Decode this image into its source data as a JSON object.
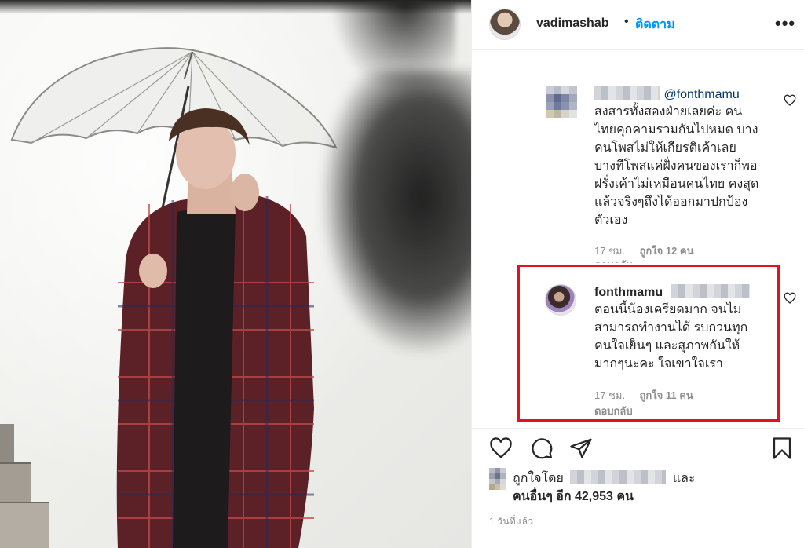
{
  "header": {
    "username": "vadimashab",
    "dot": "•",
    "follow_label": "ติดตาม",
    "more_label": "•••"
  },
  "comments": [
    {
      "mention": "@fonthmamu",
      "text": "สงสารทั้งสองฝ่ายเลยค่ะ คน\nไทยคุกคามรวมกันไปหมด บาง\nคนโพสไม่ให้เกียรติเค้าเลย\nบางทีโพสแค่ฝั่งคนของเราก็พอ\nฝรั่งเค้าไม่เหมือนคนไทย คงสุด\nแล้วจริงๆถึงได้ออกมาปกป้อง\nตัวเอง",
      "time": "17 ชม.",
      "likes": "ถูกใจ 12 คน",
      "reply": "ตอบกลับ"
    },
    {
      "username": "fonthmamu",
      "text": "ตอนนี้น้องเครียดมาก จนไม่\nสามารถทำงานได้ รบกวนทุก\nคนใจเย็นๆ และสุภาพกันให้\nมากๆนะคะ ใจเขาใจเรา",
      "time": "17 ชม.",
      "likes": "ถูกใจ 11 คน",
      "reply": "ตอบกลับ"
    }
  ],
  "likes_row": {
    "prefix": "ถูกใจโดย",
    "and": "และ",
    "others": "คนอื่นๆ อีก 42,953 คน"
  },
  "timestamp": "1 วันที่แล้ว",
  "colors": {
    "follow_blue": "#0095f6",
    "highlight_red": "#e3131e",
    "meta_gray": "#8e8e8e",
    "mention_blue": "#00376b"
  },
  "icons": [
    "more-icon",
    "heart-icon",
    "comment-icon",
    "share-icon",
    "bookmark-icon"
  ]
}
